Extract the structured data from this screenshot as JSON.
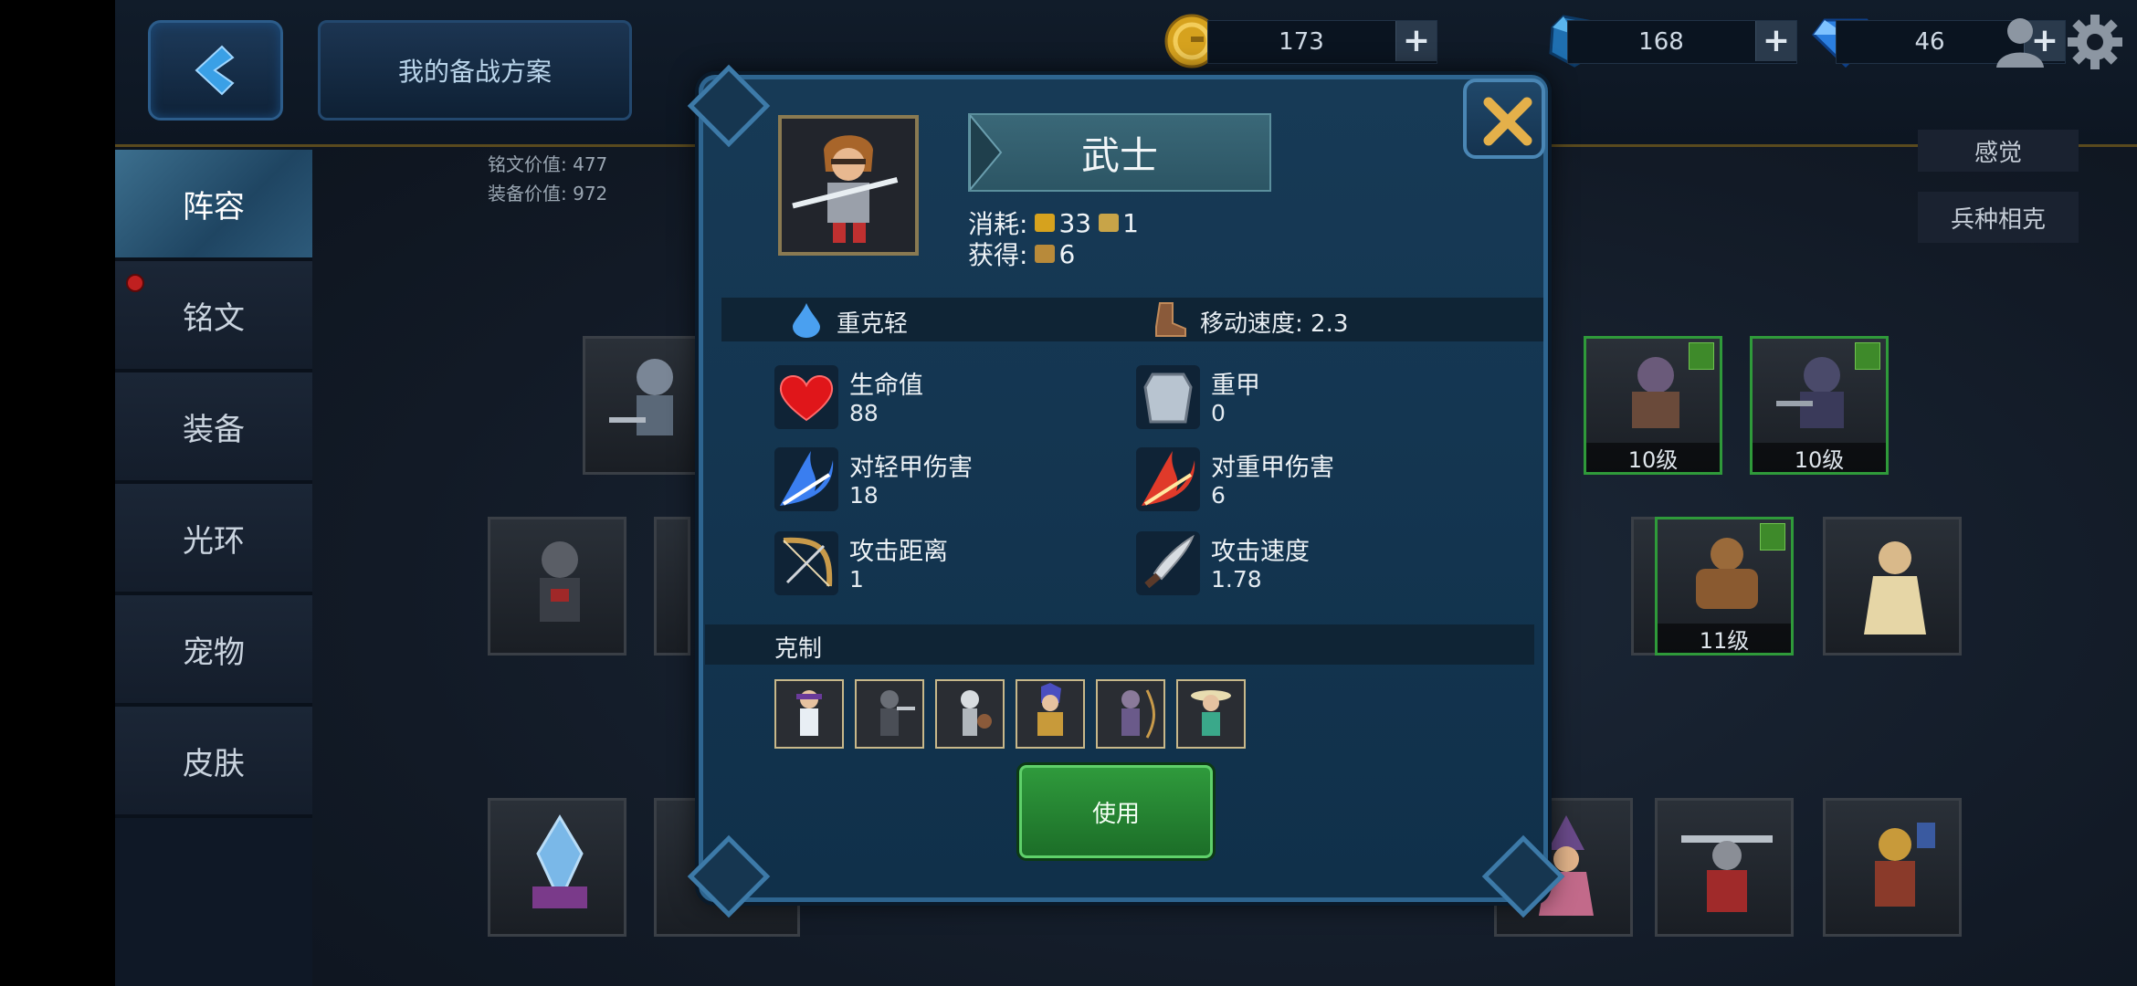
{
  "topbar": {
    "plan_label": "我的备战方案",
    "gold": "173",
    "crystal": "168",
    "diamond": "46",
    "plus": "+"
  },
  "sidebar": {
    "items": [
      {
        "label": "阵容"
      },
      {
        "label": "铭文"
      },
      {
        "label": "装备"
      },
      {
        "label": "光环"
      },
      {
        "label": "宠物"
      },
      {
        "label": "皮肤"
      }
    ]
  },
  "values": {
    "inscription": "铭文价值: 477",
    "equipment": "装备价值: 972"
  },
  "right_buttons": {
    "top_partial": "感觉",
    "counter_relation": "兵种相克"
  },
  "cards": {
    "lvl_a": "10级",
    "lvl_b": "10级",
    "lvl_c": "11级"
  },
  "unit": {
    "name": "武士",
    "cost_label": "消耗:",
    "cost_gold": "33",
    "cost_pop": "1",
    "gain_label": "获得:",
    "gain_value": "6",
    "trait": "重克轻",
    "move_speed": "移动速度: 2.3",
    "stats": [
      {
        "label": "生命值",
        "value": "88"
      },
      {
        "label": "重甲",
        "value": "0"
      },
      {
        "label": "对轻甲伤害",
        "value": "18"
      },
      {
        "label": "对重甲伤害",
        "value": "6"
      },
      {
        "label": "攻击距离",
        "value": "1"
      },
      {
        "label": "攻击速度",
        "value": "1.78"
      }
    ],
    "counter_title": "克制",
    "use_label": "使用"
  },
  "colors": {
    "accent_green": "#2f9a3c",
    "panel_blue": "#173a56",
    "gold": "#d6a21e"
  }
}
